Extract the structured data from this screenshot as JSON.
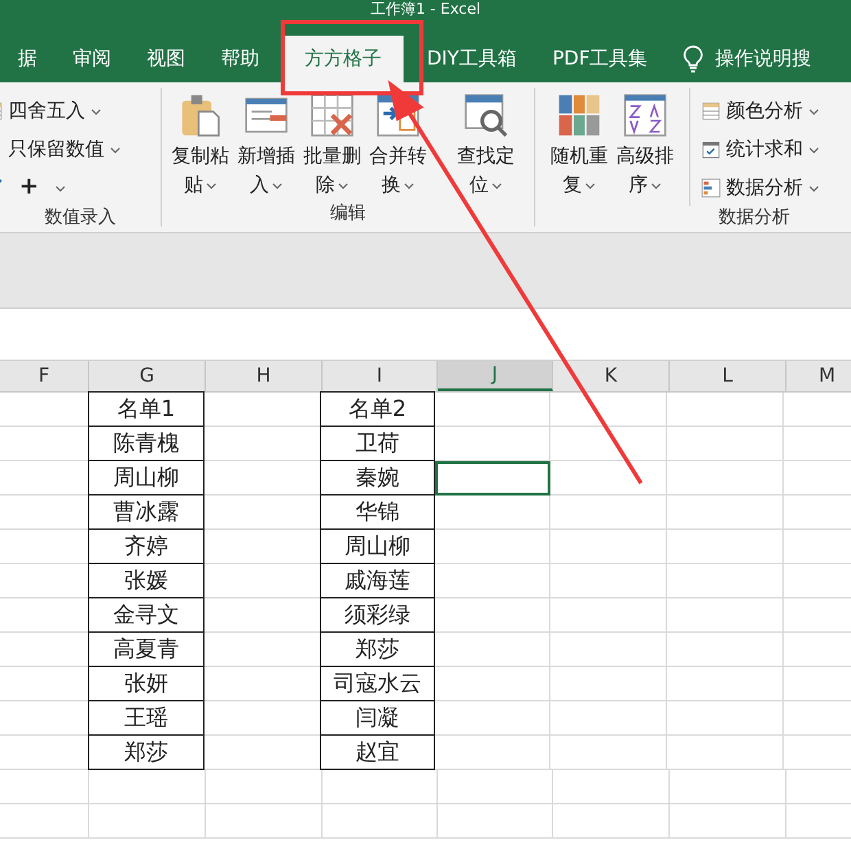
{
  "window": {
    "title": "工作簿1 - Excel"
  },
  "tabs": [
    {
      "label": "据",
      "selected": false
    },
    {
      "label": "审阅",
      "selected": false
    },
    {
      "label": "视图",
      "selected": false
    },
    {
      "label": "帮助",
      "selected": false
    },
    {
      "label": "方方格子",
      "selected": true
    },
    {
      "label": "DIY工具箱",
      "selected": false
    },
    {
      "label": "PDF工具集",
      "selected": false
    }
  ],
  "tell_me": "操作说明搜",
  "ribbon": {
    "groups": [
      {
        "label": "数值录入",
        "kind": "small",
        "items": [
          {
            "label": "四舍五入"
          },
          {
            "label": "只保留数值"
          },
          {
            "label": "+"
          }
        ]
      },
      {
        "label": "编辑",
        "kind": "large",
        "items": [
          {
            "label": "复制粘贴"
          },
          {
            "label": "新增插入"
          },
          {
            "label": "批量删除"
          },
          {
            "label": "合并转换"
          },
          {
            "label": "查找定位"
          }
        ]
      },
      {
        "label": "数据分析",
        "kind": "mixed",
        "items": [
          {
            "label": "随机重复"
          },
          {
            "label": "高级排序"
          }
        ],
        "small_items": [
          {
            "label": "颜色分析"
          },
          {
            "label": "统计求和"
          },
          {
            "label": "数据分析"
          }
        ]
      }
    ]
  },
  "sheet": {
    "columns": [
      {
        "label": "F",
        "selected": false
      },
      {
        "label": "G",
        "selected": false
      },
      {
        "label": "H",
        "selected": false
      },
      {
        "label": "I",
        "selected": false
      },
      {
        "label": "J",
        "selected": true
      },
      {
        "label": "K",
        "selected": false
      },
      {
        "label": "L",
        "selected": false
      },
      {
        "label": "M",
        "selected": false
      }
    ],
    "rows": [
      {
        "list_1": "名单1",
        "list_2": "名单2",
        "active": false
      },
      {
        "list_1": "陈青槐",
        "list_2": "卫荷",
        "active": false
      },
      {
        "list_1": "周山柳",
        "list_2": "秦婉",
        "active": true
      },
      {
        "list_1": "曹冰露",
        "list_2": "华锦",
        "active": false
      },
      {
        "list_1": "齐婷",
        "list_2": "周山柳",
        "active": false
      },
      {
        "list_1": "张媛",
        "list_2": "戚海莲",
        "active": false
      },
      {
        "list_1": "金寻文",
        "list_2": "须彩绿",
        "active": false
      },
      {
        "list_1": "高夏青",
        "list_2": "郑莎",
        "active": false
      },
      {
        "list_1": "张妍",
        "list_2": "司寇水云",
        "active": false
      },
      {
        "list_1": "王瑶",
        "list_2": "闫凝",
        "active": false
      },
      {
        "list_1": "郑莎",
        "list_2": "赵宜",
        "active": false
      }
    ]
  }
}
